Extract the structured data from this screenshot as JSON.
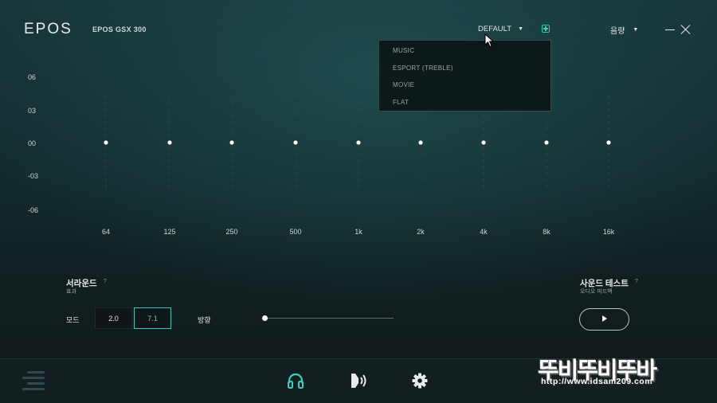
{
  "header": {
    "logo": "EPOS",
    "device": "EPOS GSX 300",
    "preset_selected": "DEFAULT",
    "volume_label": "음량"
  },
  "preset_dropdown": {
    "options": [
      "MUSIC",
      "ESPORT (TREBLE)",
      "MOVIE",
      "FLAT"
    ]
  },
  "equalizer": {
    "y_labels": [
      "06",
      "03",
      "00",
      "-03",
      "-06"
    ],
    "bands": [
      "64",
      "125",
      "250",
      "500",
      "1k",
      "2k",
      "4k",
      "8k",
      "16k"
    ],
    "gains_db": [
      0,
      0,
      0,
      0,
      0,
      0,
      0,
      0,
      0
    ],
    "range_db": [
      -6,
      6
    ],
    "accent_color": "#3ccfbd"
  },
  "surround": {
    "title": "서라운드",
    "subtitle": "효과",
    "help": "?",
    "mode_label": "모드",
    "modes": [
      "2.0",
      "7.1"
    ],
    "selected_mode": "7.1",
    "direction_label": "방향",
    "direction_value": 0
  },
  "sound_test": {
    "title": "사운드 테스트",
    "subtitle": "오디오 피드백",
    "help": "?"
  },
  "footer": {
    "icons": [
      "menu-icon",
      "headphones-icon",
      "speaker-icon",
      "gear-icon"
    ],
    "active": "headphones-icon"
  },
  "watermark": {
    "title": "뚜비뚜비뚜바",
    "url": "http://www.idsam209.com"
  }
}
